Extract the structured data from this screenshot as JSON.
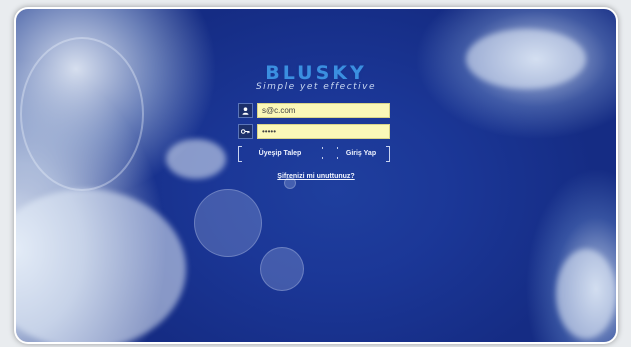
{
  "brand": {
    "name": "BLUSKY",
    "tagline": "Simple yet effective",
    "color": "#3b8fe0"
  },
  "login": {
    "username_value": "s@c.com",
    "password_value": "•••••",
    "user_icon": "user-icon",
    "password_icon": "key-icon",
    "input_background": "#fbf8b8"
  },
  "actions": {
    "register_label": "Üyeşip Talep",
    "login_label": "Giriş Yap",
    "forgot_label": "Şifrenizi mi unuttunuz?"
  },
  "theme": {
    "background": "#1b3797"
  }
}
